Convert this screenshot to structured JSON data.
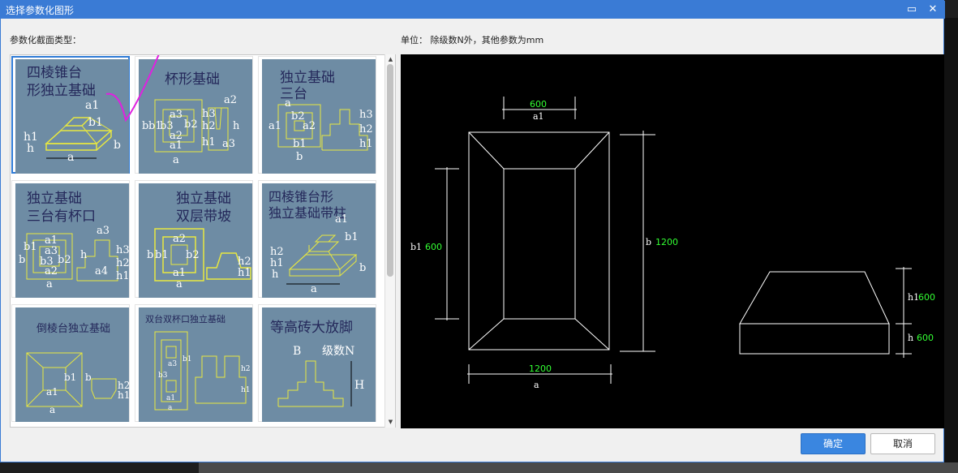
{
  "window": {
    "title": "选择参数化图形"
  },
  "titlebar": {
    "maximize_glyph": "▭",
    "close_glyph": "✕"
  },
  "section_label": "参数化截面类型：",
  "units_note": "单位： 除级数N外，其他参数为mm",
  "gallery": {
    "tiles": [
      {
        "title_lines": [
          "四棱锥台",
          "形独立基础"
        ],
        "labels": [
          "a1",
          "b1",
          "h1",
          "h",
          "a",
          "b"
        ],
        "selected": true
      },
      {
        "title_lines": [
          "杯形基础"
        ],
        "labels": [
          "b",
          "b1",
          "b3",
          "b2",
          "a3",
          "a2",
          "a1",
          "a",
          "a2",
          "h3",
          "h2",
          "h1",
          "h",
          "a3"
        ],
        "selected": false
      },
      {
        "title_lines": [
          "独立基础",
          "三台"
        ],
        "labels": [
          "a",
          "a1",
          "b2",
          "a2",
          "b1",
          "b",
          "h3",
          "h2",
          "h1"
        ],
        "selected": false
      },
      {
        "title_lines": [
          "独立基础",
          "三台有杯口"
        ],
        "labels": [
          "b1",
          "b",
          "a1",
          "a3",
          "b3",
          "b2",
          "a2",
          "a",
          "a3",
          "h",
          "a4",
          "h3",
          "h2",
          "h1"
        ],
        "selected": false
      },
      {
        "title_lines": [
          "独立基础",
          "双层带坡"
        ],
        "labels": [
          "b",
          "b1",
          "a2",
          "b2",
          "a1",
          "a",
          "h2",
          "h1"
        ],
        "selected": false
      },
      {
        "title_lines": [
          "四棱锥台形",
          "独立基础带柱"
        ],
        "labels": [
          "a1",
          "b1",
          "h2",
          "h1",
          "h",
          "a",
          "b"
        ],
        "selected": false
      },
      {
        "title_lines": [
          "倒棱台独立基础"
        ],
        "labels": [
          "b1",
          "a1",
          "a",
          "b",
          "h2",
          "h1"
        ],
        "selected": false
      },
      {
        "title_lines": [
          "双台双杯口独立基础"
        ],
        "labels": [
          "a3",
          "b3",
          "b1",
          "a1",
          "a",
          "h2",
          "h1"
        ],
        "selected": false
      },
      {
        "title_lines": [
          "等高砖大放脚"
        ],
        "labels": [
          "B",
          "级数N",
          "H"
        ],
        "selected": false
      }
    ]
  },
  "preview": {
    "plan": {
      "top_value": "600",
      "top_label": "a1",
      "left_label": "b1",
      "left_value": "600",
      "right_label": "b",
      "right_value": "1200",
      "bottom_value": "1200",
      "bottom_label": "a"
    },
    "section": {
      "h1_label": "h1",
      "h1_value": "600",
      "h_label": "h",
      "h_value": "600"
    }
  },
  "buttons": {
    "ok": "确定",
    "cancel": "取消"
  },
  "colors": {
    "accent": "#3a7bd5",
    "tile_bg": "#6e8ca4",
    "dim_green": "#33ff33",
    "yellow": "#e8e840",
    "check_mark": "#e020e0"
  }
}
